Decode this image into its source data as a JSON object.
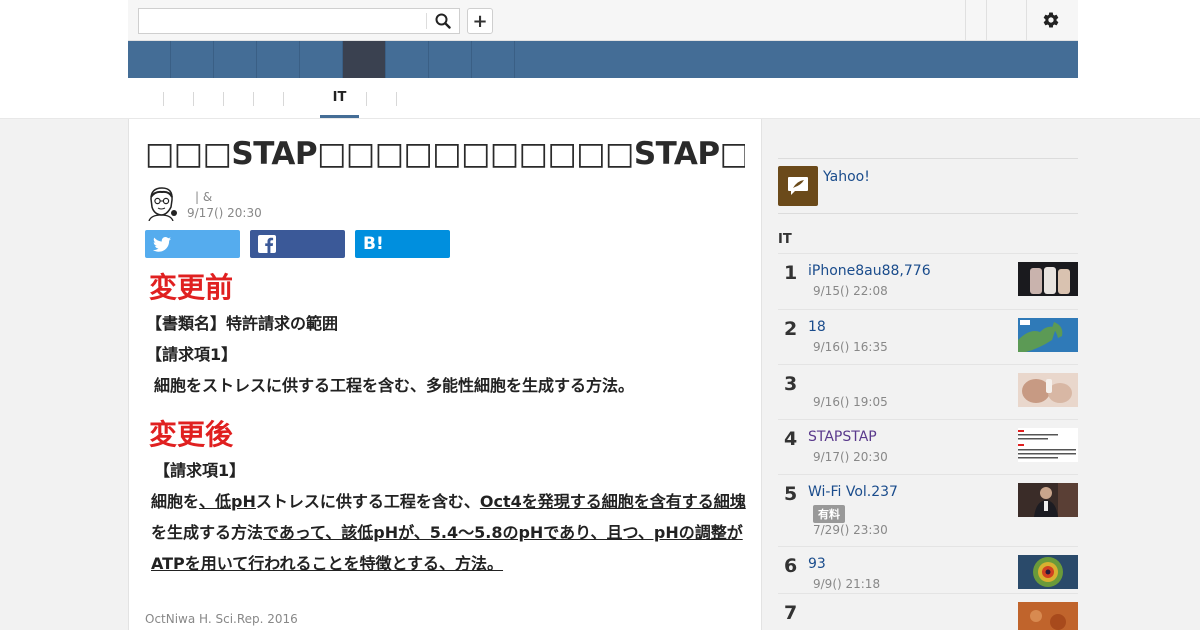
{
  "search": {
    "placeholder": "",
    "value": ""
  },
  "toolbar": {
    "add_label": "+"
  },
  "subnav": {
    "active_label": "IT"
  },
  "article": {
    "title": "□□□STAP□□□□□□□□□□□STAP□□□□□",
    "author_line": "| &",
    "date": "9/17() 20:30",
    "share_hatena_label": "B!",
    "patent": {
      "before_head": "変更前",
      "before_line1": "【書類名】特許請求の範囲",
      "before_line2": "【請求項1】",
      "before_line3": "細胞をストレスに供する工程を含む、多能性細胞を生成する方法。",
      "after_head": "変更後",
      "after_line1": "【請求項1】",
      "after_body_1": "細胞を",
      "after_body_2": "、低pH",
      "after_body_3": "ストレスに供する工程を含む、",
      "after_body_4": "Oct4を発現する細胞を含有する細塊",
      "after_body_5": "を生成する方法",
      "after_body_6": "であって、該低pHが、5.4〜5.8のpHであり、且つ、pHの調整がATPを用いて行われることを特徴とする、方法。"
    },
    "caption": "OctNiwa H. Sci.Rep. 2016"
  },
  "sidebar": {
    "yahoo_label": "Yahoo!",
    "ranking_title": "IT",
    "items": [
      {
        "rank": "1",
        "title": "iPhone8au88,776",
        "date": "9/15() 22:08",
        "badge": ""
      },
      {
        "rank": "2",
        "title": "18",
        "date": "9/16() 16:35",
        "badge": ""
      },
      {
        "rank": "3",
        "title": "",
        "date": "9/16() 19:05",
        "badge": ""
      },
      {
        "rank": "4",
        "title": "STAPSTAP",
        "date": "9/17() 20:30",
        "badge": ""
      },
      {
        "rank": "5",
        "title": "Wi-Fi  Vol.237",
        "date": "7/29() 23:30",
        "badge": "有料"
      },
      {
        "rank": "6",
        "title": "93",
        "date": "9/9() 21:18",
        "badge": ""
      },
      {
        "rank": "7",
        "title": "",
        "date": "",
        "badge": ""
      }
    ]
  },
  "colors": {
    "nav": "#446d96",
    "nav_active": "#3a4150",
    "twitter": "#55acee",
    "facebook": "#3b5998",
    "hatena": "#008fde",
    "red": "#e02020"
  }
}
